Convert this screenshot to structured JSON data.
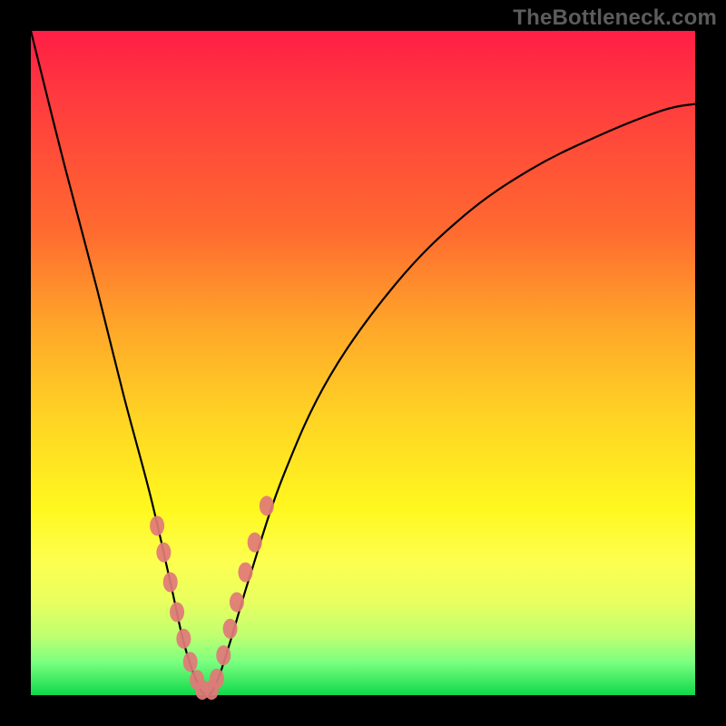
{
  "watermark": {
    "text": "TheBottleneck.com"
  },
  "chart_data": {
    "type": "line",
    "title": "",
    "xlabel": "",
    "ylabel": "",
    "xlim": [
      0,
      100
    ],
    "ylim": [
      0,
      100
    ],
    "grid": false,
    "note": "V-shaped curve on a red→green vertical gradient; minimum touches the bottom (green). No axis ticks or labels shown.",
    "series": [
      {
        "name": "curve",
        "x": [
          0,
          5,
          10,
          14,
          18,
          21,
          23,
          25,
          26.5,
          28,
          30,
          33,
          38,
          45,
          55,
          65,
          75,
          85,
          95,
          100
        ],
        "values": [
          100,
          80,
          61,
          45,
          30,
          17,
          8,
          2,
          0,
          2,
          8,
          18,
          33,
          48,
          62,
          72,
          79,
          84,
          88,
          89
        ]
      }
    ],
    "markers": {
      "note": "Salmon-colored oval markers placed along the near-bottom flanks of the curve.",
      "x": [
        19.0,
        20.0,
        21.0,
        22.0,
        23.0,
        24.0,
        25.0,
        25.8,
        27.2,
        28.0,
        29.0,
        30.0,
        31.0,
        32.3,
        33.7,
        35.5
      ],
      "values": [
        25.5,
        21.5,
        17.0,
        12.5,
        8.5,
        5.0,
        2.3,
        0.8,
        0.8,
        2.5,
        6.0,
        10.0,
        14.0,
        18.5,
        23.0,
        28.5
      ],
      "color": "#e07a78"
    }
  }
}
